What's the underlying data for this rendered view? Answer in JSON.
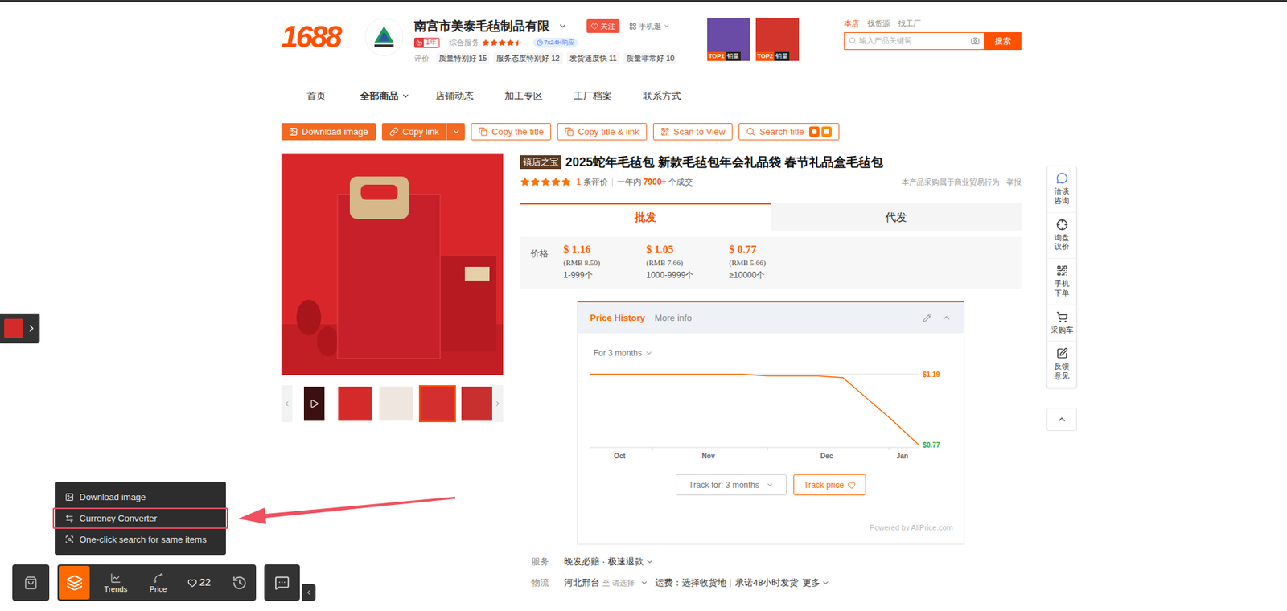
{
  "header": {
    "logo": "1688",
    "store_name": "南宫市美泰毛毡制品有限",
    "follow_button": "关注",
    "mobile_link": "手机逛",
    "years_badge": "1年",
    "service_label": "综合服务",
    "service_stars": 4.5,
    "response_badge": "7x24H响应",
    "reviews_label": "评价",
    "review_tags": [
      {
        "label": "质量特别好",
        "count": "15"
      },
      {
        "label": "服务态度特别好",
        "count": "12"
      },
      {
        "label": "发货速度快",
        "count": "11"
      },
      {
        "label": "质量非常好",
        "count": "10"
      }
    ],
    "top_products": [
      {
        "rank": "TOP1",
        "label": "销量"
      },
      {
        "rank": "TOP2",
        "label": "销量"
      }
    ]
  },
  "search": {
    "scopes": [
      {
        "label": "本店",
        "selected": true
      },
      {
        "label": "找货源",
        "selected": false
      },
      {
        "label": "找工厂",
        "selected": false
      }
    ],
    "placeholder": "输入产品关键词",
    "button": "搜索"
  },
  "nav": [
    {
      "label": "首页",
      "selected": false,
      "dropdown": false
    },
    {
      "label": "全部商品",
      "selected": true,
      "dropdown": true
    },
    {
      "label": "店铺动态",
      "selected": false,
      "dropdown": false
    },
    {
      "label": "加工专区",
      "selected": false,
      "dropdown": false
    },
    {
      "label": "工厂档案",
      "selected": false,
      "dropdown": false
    },
    {
      "label": "联系方式",
      "selected": false,
      "dropdown": false
    }
  ],
  "toolbar": [
    {
      "label": "Download image",
      "kind": "download",
      "primary": true
    },
    {
      "label": "Copy link",
      "kind": "copy-link",
      "primary": true
    },
    {
      "label": "Copy the title",
      "kind": "copy-title",
      "primary": false
    },
    {
      "label": "Copy title & link",
      "kind": "copy-title-link",
      "primary": false
    },
    {
      "label": "Scan to View",
      "kind": "scan",
      "primary": false
    },
    {
      "label": "Search title",
      "kind": "search",
      "primary": false
    }
  ],
  "gallery": {
    "thumbnails": [
      {
        "kind": "video",
        "selected": false
      },
      {
        "kind": "image",
        "selected": false
      },
      {
        "kind": "image",
        "selected": false
      },
      {
        "kind": "image",
        "selected": true
      },
      {
        "kind": "image",
        "selected": false
      }
    ]
  },
  "product": {
    "badge": "镇店之宝",
    "title": "2025蛇年毛毡包 新款毛毡包年会礼品袋 春节礼品盒毛毡包",
    "stars": 5,
    "review_count": "1",
    "review_label": "条评价",
    "period": "一年内",
    "sold": "7900+",
    "sold_label": "个成交",
    "notice": "本产品采购属于商业贸易行为",
    "report": "举报"
  },
  "mode_tabs": [
    {
      "label": "批发",
      "selected": true
    },
    {
      "label": "代发",
      "selected": false
    }
  ],
  "price": {
    "label": "价格",
    "tiers": [
      {
        "usd": "$ 1.16",
        "rmb": "(RMB 8.50)",
        "range": "1-999个"
      },
      {
        "usd": "$ 1.05",
        "rmb": "(RMB 7.66)",
        "range": "1000-9999个"
      },
      {
        "usd": "$ 0.77",
        "rmb": "(RMB 5.66)",
        "range": "≥10000个"
      }
    ]
  },
  "price_history": {
    "tabs": [
      {
        "label": "Price History",
        "selected": true
      },
      {
        "label": "More info",
        "selected": false
      }
    ],
    "expanded": true,
    "period_select": "For 3 months",
    "chart": {
      "series": [
        {
          "name": "price",
          "color": "#ff6a00",
          "values": [
            1.19,
            1.19,
            1.19,
            1.19,
            1.19,
            1.19,
            1.19,
            1.18,
            1.18,
            1.18,
            1.17,
            1.04,
            0.91,
            0.77
          ]
        }
      ],
      "max_label": "$1.19",
      "min_label": "$0.77",
      "x_ticks": [
        "Oct",
        "Nov",
        "Dec",
        "Jan"
      ]
    },
    "track_select": "Track for: 3 months",
    "track_button": "Track price",
    "footer": "Powered by AliPrice.com"
  },
  "details": {
    "service": {
      "label": "服务",
      "value": "晚发必赔 · 极速退款"
    },
    "logistics": {
      "label": "物流",
      "origin": "河北邢台",
      "to": "至",
      "destination": "请选择",
      "freight": "运费：选择收货地",
      "promise": "承诺48小时发货",
      "more": "更多"
    }
  },
  "side_tools": [
    {
      "label": "洽谈咨询",
      "kind": "chat"
    },
    {
      "label": "询盘议价",
      "kind": "inquiry"
    },
    {
      "label": "手机下单",
      "kind": "mobile"
    },
    {
      "label": "采购车",
      "kind": "cart"
    },
    {
      "label": "反馈意见",
      "kind": "feedback"
    }
  ],
  "popup_menu": [
    {
      "label": "Download image",
      "kind": "download",
      "selected": false
    },
    {
      "label": "Currency Converter",
      "kind": "currency",
      "selected": true
    },
    {
      "label": "One-click search for same items",
      "kind": "same-items",
      "selected": false
    }
  ],
  "bottom_bar": {
    "items": [
      {
        "kind": "menu",
        "selected": true
      },
      {
        "kind": "trends",
        "label": "Trends",
        "selected": false
      },
      {
        "kind": "price",
        "label": "Price",
        "selected": false
      },
      {
        "kind": "favorites",
        "label": "22",
        "selected": false
      },
      {
        "kind": "history",
        "selected": false
      }
    ]
  }
}
